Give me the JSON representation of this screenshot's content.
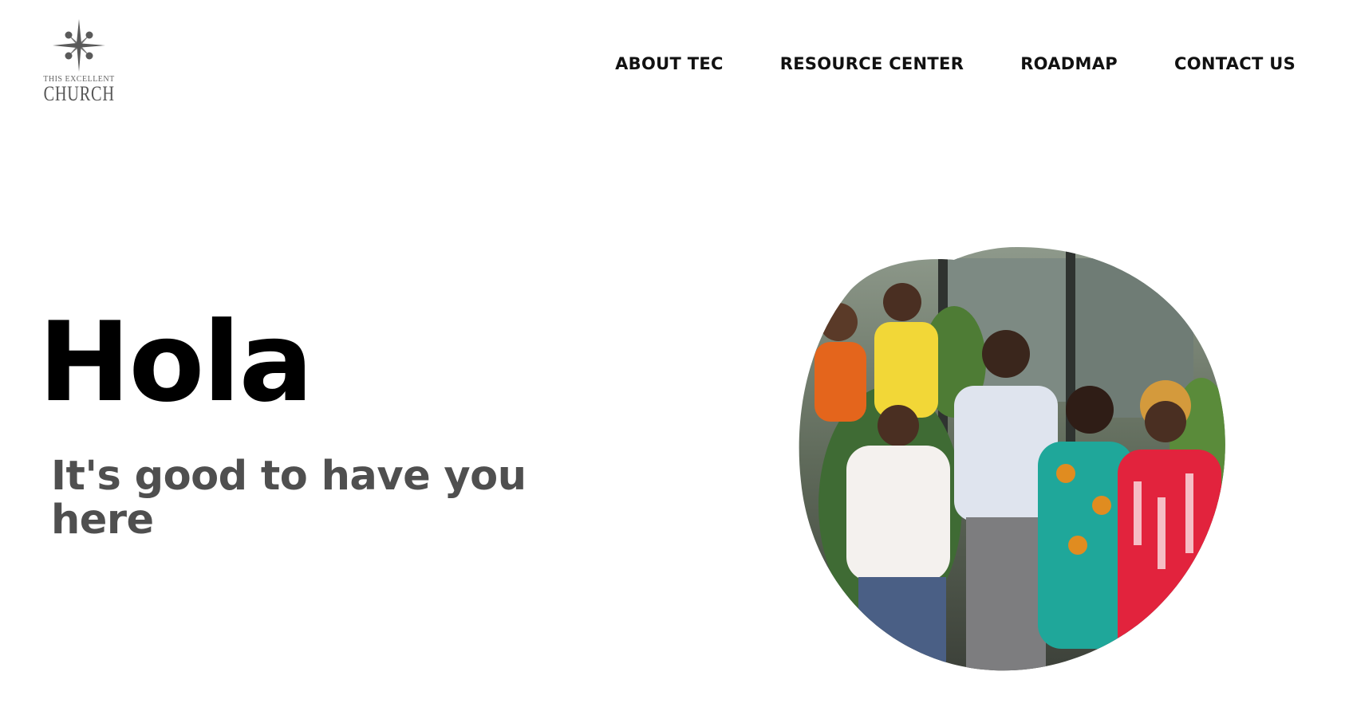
{
  "logo": {
    "line1": "THIS EXCELLENT",
    "line2": "CHURCH",
    "icon": "compass-star-icon"
  },
  "nav": {
    "items": [
      {
        "label": "ABOUT TEC"
      },
      {
        "label": "RESOURCE CENTER"
      },
      {
        "label": "ROADMAP"
      },
      {
        "label": "CONTACT US"
      }
    ]
  },
  "hero": {
    "title": "Hola",
    "subtitle": "It's good to have you here"
  },
  "photo": {
    "icon": "group-photo-image"
  },
  "colors": {
    "text": "#000000",
    "subtitle": "#4f4f4f",
    "background": "#ffffff"
  }
}
